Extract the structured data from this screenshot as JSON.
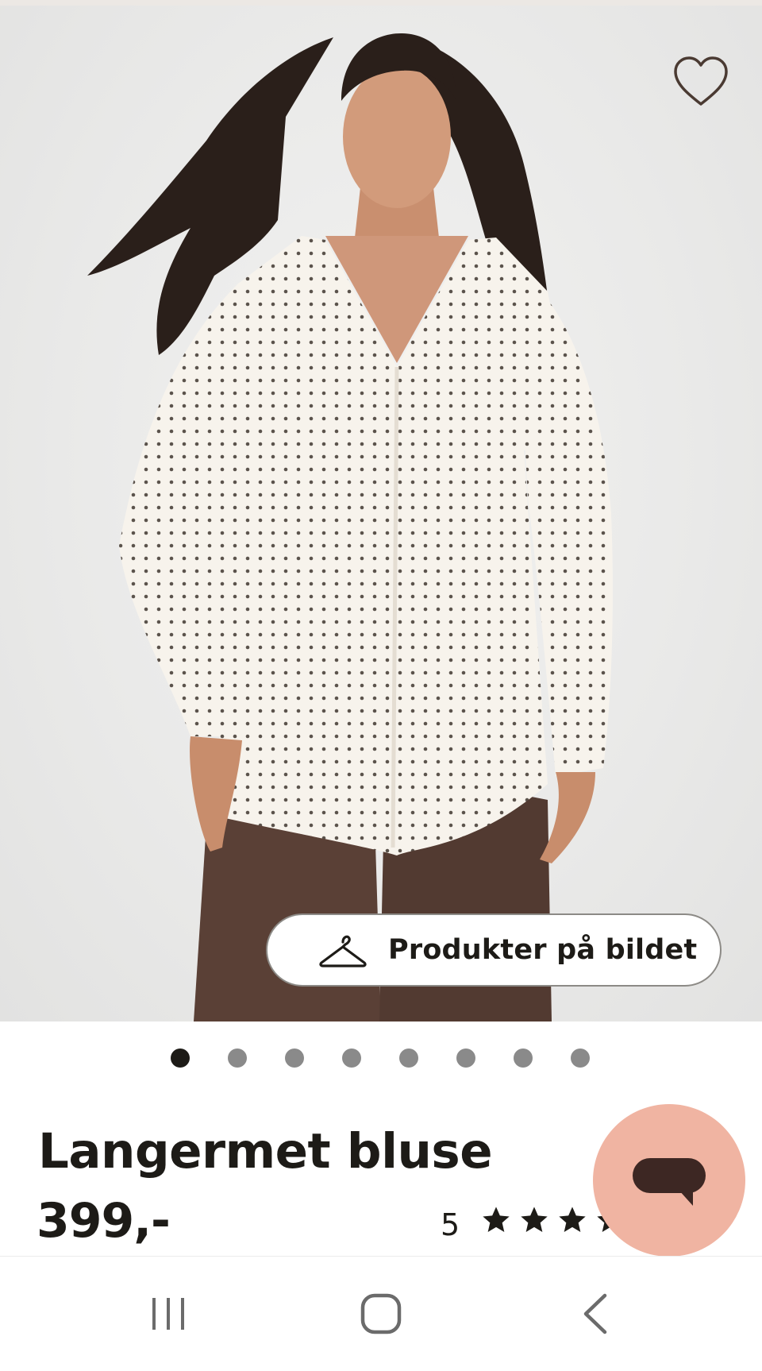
{
  "product": {
    "title": "Langermet bluse",
    "price": "399,-",
    "rating_count": "5",
    "rating_stars": 5
  },
  "image": {
    "products_in_image_label": "Produkter på bildet",
    "products_in_image_icon": "hanger-icon",
    "favorite_icon": "heart-outline-icon",
    "pager": {
      "total": 8,
      "active_index": 0
    }
  },
  "chat": {
    "icon": "chat-bubble-icon"
  },
  "system_nav": {
    "recents_icon": "recents-icon",
    "home_icon": "home-icon",
    "back_icon": "back-icon"
  },
  "colors": {
    "text": "#1d1b17",
    "chat_fab": "#f0b4a2",
    "chat_icon": "#3d2723",
    "dot_active": "#1d1b17",
    "dot_inactive": "#8a8a8a"
  }
}
